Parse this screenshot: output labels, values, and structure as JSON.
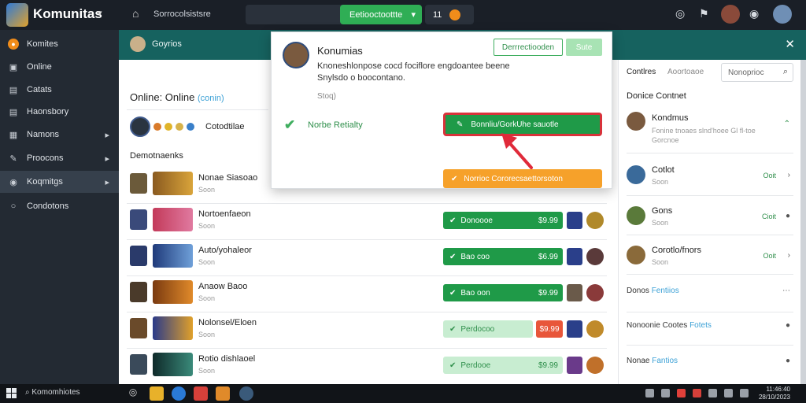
{
  "app": {
    "title": "Komunitas",
    "chevron": "▾",
    "path": "Sorrocolsistsre"
  },
  "topbar": {
    "green_pill_label": "Eetiooctoottte",
    "green_pill_chevron": "▾",
    "count": "11",
    "icons": [
      "globe-icon",
      "flag-icon",
      "bell-icon",
      "settings-icon"
    ]
  },
  "sidebar": {
    "items": [
      {
        "label": "Komites",
        "icon": "coin-icon",
        "arrow": ""
      },
      {
        "label": "Online",
        "icon": "people-icon",
        "arrow": ""
      },
      {
        "label": "Catats",
        "icon": "list-icon",
        "arrow": ""
      },
      {
        "label": "Haonsbory",
        "icon": "list-icon",
        "arrow": ""
      },
      {
        "label": "Namons",
        "icon": "store-icon",
        "arrow": "▸"
      },
      {
        "label": "Proocons",
        "icon": "wrench-icon",
        "arrow": "▸"
      },
      {
        "label": "Koqmitgs",
        "icon": "chat-icon",
        "arrow": "▸"
      },
      {
        "label": "Condotons",
        "icon": "circle-icon",
        "arrow": ""
      }
    ]
  },
  "main_header": {
    "title": "Goyrios",
    "close": "✕"
  },
  "content": {
    "online_title": "Online: Online",
    "online_link": "(conin)",
    "chip_label": "Cotodtilae",
    "section_label": "Demotnaenks",
    "rows": [
      {
        "name": "Nonae Siasoao",
        "sub": "Soon",
        "status": "",
        "price": "",
        "style": "none"
      },
      {
        "name": "Nortoenfaeon",
        "sub": "Soon",
        "status": "Donoooe",
        "price": "$9.99",
        "style": "green"
      },
      {
        "name": "Auto/yohaleor",
        "sub": "Soon",
        "status": "Bao coo",
        "price": "$6.99",
        "style": "green"
      },
      {
        "name": "Anaow Baoo",
        "sub": "Soon",
        "status": "Bao oon",
        "price": "$9.99",
        "style": "green"
      },
      {
        "name": "Nolonsel/Eloen",
        "sub": "Soon",
        "status": "Perdocoo",
        "price": "$9.99",
        "style": "light-red"
      },
      {
        "name": "Rotio dishlaoel",
        "sub": "Soon",
        "status": "Perdooe",
        "price": "$9.99",
        "style": "light"
      }
    ]
  },
  "popup": {
    "title": "Konumias",
    "text": "Knoneshlonpose cocd fociflore engdoantee beene Snylsdo o boocontano.",
    "small": "Stoq)",
    "btn_outline": "Derrrectiooden",
    "btn_light": "Sute",
    "check_label": "Norbe Retialty",
    "primary": "Bonnliu/GorkUhe sauotle",
    "orange": "Norrioc Cororecsaettorsoton"
  },
  "right": {
    "tabs": [
      "Contlres",
      "Aoortoaoe"
    ],
    "search_placeholder": "Nonoprioc",
    "section": "Donice Contnet",
    "featured": {
      "name": "Kondmus",
      "sub": "Fonine tnoaes slnd'hoee Gl fl-toe Gorcnoe"
    },
    "friends": [
      {
        "name": "Cotlot",
        "sub": "Soon",
        "status": "Ooit"
      },
      {
        "name": "Gons",
        "sub": "Soon",
        "status": "Cioit"
      },
      {
        "name": "Corotlo/fnors",
        "sub": "Soon",
        "status": "Ooit"
      }
    ],
    "links": [
      {
        "text": "Donos ",
        "link": "Fentiios"
      },
      {
        "text": "Nonoonie Cootes ",
        "link": "Fotets"
      },
      {
        "text": "Nonae ",
        "link": "Fantios"
      }
    ]
  },
  "taskbar": {
    "search": "Komomhiotes",
    "clock_time": "11:46:40",
    "clock_date": "28/10/2023"
  }
}
